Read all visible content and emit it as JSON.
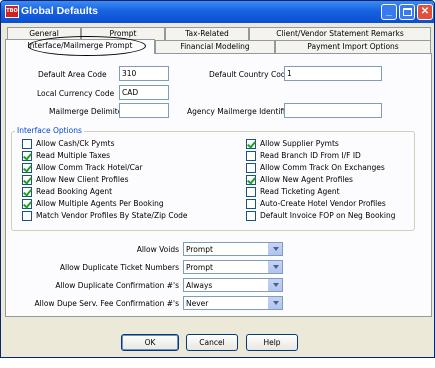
{
  "window": {
    "title": "Global Defaults",
    "app_icon": "TBO",
    "controls": {
      "minimize": "_",
      "close": "✕"
    }
  },
  "tabs": {
    "row1": [
      "General",
      "Prompt",
      "Tax-Related",
      "Client/Vendor Statement Remarks"
    ],
    "row2": [
      "Interface/Mailmerge Prompt",
      "Financial Modeling",
      "Payment Import Options"
    ],
    "active": "Interface/Mailmerge Prompt"
  },
  "fields": {
    "default_area_code": {
      "label": "Default Area Code",
      "value": "310"
    },
    "default_country_code": {
      "label": "Default Country Code",
      "value": "1"
    },
    "local_currency_code": {
      "label": "Local Currency Code",
      "value": "CAD"
    },
    "mailmerge_delimiter": {
      "label": "Mailmerge Delimiter",
      "value": ""
    },
    "agency_mailmerge_identifier": {
      "label": "Agency Mailmerge Identifier",
      "value": ""
    }
  },
  "interface_options": {
    "title": "Interface Options",
    "left": [
      {
        "label": "Allow Cash/Ck Pymts",
        "checked": false
      },
      {
        "label": "Read Multiple Taxes",
        "checked": true
      },
      {
        "label": "Allow Comm Track Hotel/Car",
        "checked": true
      },
      {
        "label": "Allow New Client Profiles",
        "checked": true
      },
      {
        "label": "Read Booking Agent",
        "checked": true
      },
      {
        "label": "Allow Multiple Agents Per Booking",
        "checked": true
      },
      {
        "label": "Match Vendor Profiles By State/Zip Code",
        "checked": false
      }
    ],
    "right": [
      {
        "label": "Allow Supplier Pymts",
        "checked": true
      },
      {
        "label": "Read Branch ID From I/F ID",
        "checked": false
      },
      {
        "label": "Allow Comm Track On Exchanges",
        "checked": false
      },
      {
        "label": "Allow New Agent Profiles",
        "checked": true
      },
      {
        "label": "Read Ticketing Agent",
        "checked": false
      },
      {
        "label": "Auto-Create Hotel Vendor Profiles",
        "checked": false
      },
      {
        "label": "Default Invoice FOP on Neg Booking",
        "checked": false
      }
    ]
  },
  "dropdowns": [
    {
      "label": "Allow Voids",
      "value": "Prompt"
    },
    {
      "label": "Allow Duplicate Ticket Numbers",
      "value": "Prompt"
    },
    {
      "label": "Allow Duplicate Confirmation #'s",
      "value": "Always"
    },
    {
      "label": "Allow Dupe Serv. Fee Confirmation #'s",
      "value": "Never"
    }
  ],
  "buttons": {
    "ok": "OK",
    "cancel": "Cancel",
    "help": "Help"
  }
}
